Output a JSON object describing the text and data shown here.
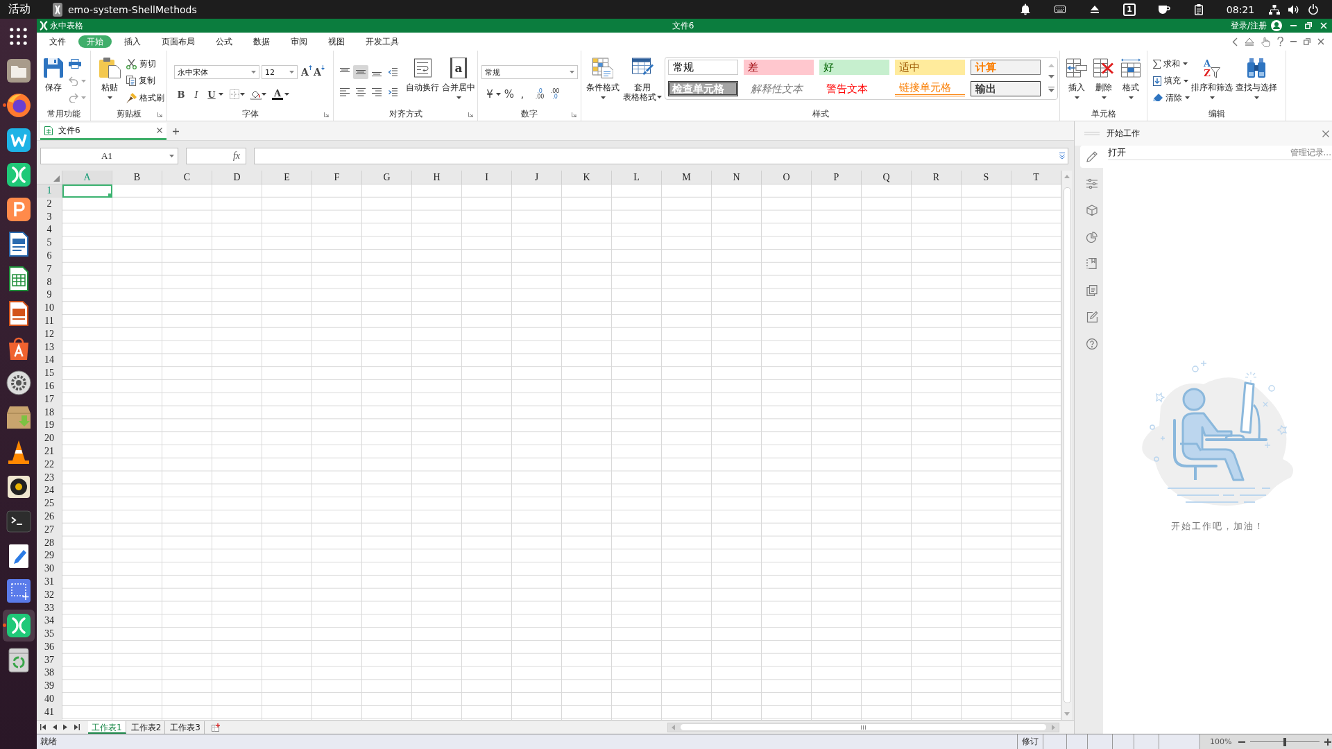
{
  "top_bar": {
    "activities": "活动",
    "app_title": "emo-system-ShellMethods",
    "workspace": "1",
    "clock": "08:21"
  },
  "dock": [
    {
      "kind": "grid",
      "running": false,
      "selected": false
    },
    {
      "kind": "files",
      "running": false,
      "selected": false
    },
    {
      "kind": "firefox",
      "running": true,
      "selected": false
    },
    {
      "kind": "writer",
      "running": false,
      "selected": false
    },
    {
      "kind": "sheets",
      "running": false,
      "selected": false
    },
    {
      "kind": "slides",
      "running": false,
      "selected": false
    },
    {
      "kind": "lodoc",
      "running": false,
      "selected": false
    },
    {
      "kind": "localc",
      "running": false,
      "selected": false
    },
    {
      "kind": "loimpress",
      "running": false,
      "selected": false
    },
    {
      "kind": "store",
      "running": false,
      "selected": false
    },
    {
      "kind": "settings",
      "running": false,
      "selected": false
    },
    {
      "kind": "package",
      "running": false,
      "selected": false
    },
    {
      "kind": "cone",
      "running": false,
      "selected": false
    },
    {
      "kind": "speaker",
      "running": false,
      "selected": false
    },
    {
      "kind": "terminal",
      "running": false,
      "selected": false
    },
    {
      "kind": "editor",
      "running": false,
      "selected": false
    },
    {
      "kind": "screenshot",
      "running": false,
      "selected": false
    },
    {
      "kind": "sheets",
      "running": true,
      "selected": true
    },
    {
      "kind": "trash",
      "running": false,
      "selected": false
    }
  ],
  "window": {
    "app_name": "永中表格",
    "document_title": "文件6",
    "login": "登录/注册"
  },
  "menu_tabs": [
    {
      "label": "文件",
      "selected": false
    },
    {
      "label": "开始",
      "selected": true
    },
    {
      "label": "插入",
      "selected": false
    },
    {
      "label": "页面布局",
      "selected": false
    },
    {
      "label": "公式",
      "selected": false
    },
    {
      "label": "数据",
      "selected": false
    },
    {
      "label": "审阅",
      "selected": false
    },
    {
      "label": "视图",
      "selected": false
    },
    {
      "label": "开发工具",
      "selected": false
    }
  ],
  "ribbon": {
    "common": {
      "label": "常用功能",
      "save": "保存",
      "undo": {
        "disabled": true
      },
      "redo": {
        "disabled": true
      }
    },
    "clipboard": {
      "label": "剪贴板",
      "paste": "粘贴",
      "cut": "剪切",
      "copy": "复制",
      "format_painter": "格式刷"
    },
    "font": {
      "label": "字体",
      "font_name": "永中宋体",
      "font_size": "12",
      "grow": "A",
      "shrink": "A",
      "bold": "B",
      "italic": "I",
      "underline": "U",
      "font_color": "A"
    },
    "alignment": {
      "label": "对齐方式",
      "buttons": [
        {
          "kind": "top",
          "selected": false
        },
        {
          "kind": "middle",
          "selected": true
        },
        {
          "kind": "bottom",
          "selected": false
        },
        {
          "kind": "outdent",
          "selected": false
        },
        {
          "kind": "left",
          "selected": false
        },
        {
          "kind": "center",
          "selected": false
        },
        {
          "kind": "right",
          "selected": false
        },
        {
          "kind": "indent",
          "selected": false
        }
      ],
      "wrap_text": "自动换行",
      "merge_glyph": "a",
      "merge_center": "合并居中"
    },
    "number": {
      "label": "数字",
      "format": "常规",
      "currency": "¥",
      "percent": "%",
      "comma": ",",
      "increase_decimal": [
        ".0",
        ".00"
      ],
      "decrease_decimal": [
        ".00",
        ".0"
      ]
    },
    "styles": {
      "label": "样式",
      "conditional_format": "条件格式",
      "table_format": [
        "套用",
        "表格格式"
      ],
      "gallery": [
        {
          "label": "常规",
          "kind": "normal"
        },
        {
          "label": "差",
          "kind": "bad"
        },
        {
          "label": "好",
          "kind": "good"
        },
        {
          "label": "适中",
          "kind": "neutral"
        },
        {
          "label": "计算",
          "kind": "calculation"
        },
        {
          "label": "检查单元格",
          "kind": "check"
        },
        {
          "label": "解释性文本",
          "kind": "explanatory"
        },
        {
          "label": "警告文本",
          "kind": "warning"
        },
        {
          "label": "链接单元格",
          "kind": "linked"
        },
        {
          "label": "输出",
          "kind": "output"
        }
      ]
    },
    "cells": {
      "label": "单元格",
      "insert": "插入",
      "delete": "删除",
      "format": "格式"
    },
    "editing": {
      "label": "编辑",
      "sum": "求和",
      "fill": "填充",
      "clear": "清除",
      "sort_letters": [
        "A",
        "Z"
      ],
      "sort_filter": "排序和筛选",
      "find_select": "查找与选择"
    }
  },
  "doc_tabs": [
    {
      "label": "文件6",
      "selected": true
    }
  ],
  "formula_bar": {
    "name_box": "A1",
    "fx": "fx"
  },
  "sheet": {
    "columns": [
      {
        "label": "A",
        "selected": true
      },
      {
        "label": "B",
        "selected": false
      },
      {
        "label": "C",
        "selected": false
      },
      {
        "label": "D",
        "selected": false
      },
      {
        "label": "E",
        "selected": false
      },
      {
        "label": "F",
        "selected": false
      },
      {
        "label": "G",
        "selected": false
      },
      {
        "label": "H",
        "selected": false
      },
      {
        "label": "I",
        "selected": false
      },
      {
        "label": "J",
        "selected": false
      },
      {
        "label": "K",
        "selected": false
      },
      {
        "label": "L",
        "selected": false
      },
      {
        "label": "M",
        "selected": false
      },
      {
        "label": "N",
        "selected": false
      },
      {
        "label": "O",
        "selected": false
      },
      {
        "label": "P",
        "selected": false
      },
      {
        "label": "Q",
        "selected": false
      },
      {
        "label": "R",
        "selected": false
      },
      {
        "label": "S",
        "selected": false
      },
      {
        "label": "T",
        "selected": false
      }
    ],
    "rows": [
      {
        "label": "1",
        "selected": true
      },
      {
        "label": "2",
        "selected": false
      },
      {
        "label": "3",
        "selected": false
      },
      {
        "label": "4",
        "selected": false
      },
      {
        "label": "5",
        "selected": false
      },
      {
        "label": "6",
        "selected": false
      },
      {
        "label": "7",
        "selected": false
      },
      {
        "label": "8",
        "selected": false
      },
      {
        "label": "9",
        "selected": false
      },
      {
        "label": "10",
        "selected": false
      },
      {
        "label": "11",
        "selected": false
      },
      {
        "label": "12",
        "selected": false
      },
      {
        "label": "13",
        "selected": false
      },
      {
        "label": "14",
        "selected": false
      },
      {
        "label": "15",
        "selected": false
      },
      {
        "label": "16",
        "selected": false
      },
      {
        "label": "17",
        "selected": false
      },
      {
        "label": "18",
        "selected": false
      },
      {
        "label": "19",
        "selected": false
      },
      {
        "label": "20",
        "selected": false
      },
      {
        "label": "21",
        "selected": false
      },
      {
        "label": "22",
        "selected": false
      },
      {
        "label": "23",
        "selected": false
      },
      {
        "label": "24",
        "selected": false
      },
      {
        "label": "25",
        "selected": false
      },
      {
        "label": "26",
        "selected": false
      },
      {
        "label": "27",
        "selected": false
      },
      {
        "label": "28",
        "selected": false
      },
      {
        "label": "29",
        "selected": false
      },
      {
        "label": "30",
        "selected": false
      },
      {
        "label": "31",
        "selected": false
      },
      {
        "label": "32",
        "selected": false
      },
      {
        "label": "33",
        "selected": false
      },
      {
        "label": "34",
        "selected": false
      },
      {
        "label": "35",
        "selected": false
      },
      {
        "label": "36",
        "selected": false
      },
      {
        "label": "37",
        "selected": false
      },
      {
        "label": "38",
        "selected": false
      },
      {
        "label": "39",
        "selected": false
      },
      {
        "label": "40",
        "selected": false
      },
      {
        "label": "41",
        "selected": false
      }
    ]
  },
  "sheet_tabs": [
    {
      "label": "工作表1",
      "selected": true
    },
    {
      "label": "工作表2",
      "selected": false
    },
    {
      "label": "工作表3",
      "selected": false
    }
  ],
  "task_pane": {
    "title": "开始工作",
    "open": "打开",
    "manage": "管理记录...",
    "message": "开始工作吧，加油！",
    "tools": [
      {
        "kind": "pencil",
        "selected": true
      },
      {
        "kind": "sliders",
        "selected": false
      },
      {
        "kind": "cube",
        "selected": false
      },
      {
        "kind": "pie",
        "selected": false
      },
      {
        "kind": "bookmark",
        "selected": false
      },
      {
        "kind": "copy",
        "selected": false
      },
      {
        "kind": "edit",
        "selected": false
      },
      {
        "kind": "help",
        "selected": false
      }
    ]
  },
  "status_bar": {
    "status": "就绪",
    "revision": "修订",
    "zoom": "100%",
    "zoom_slider": {
      "level": 0.5
    }
  }
}
